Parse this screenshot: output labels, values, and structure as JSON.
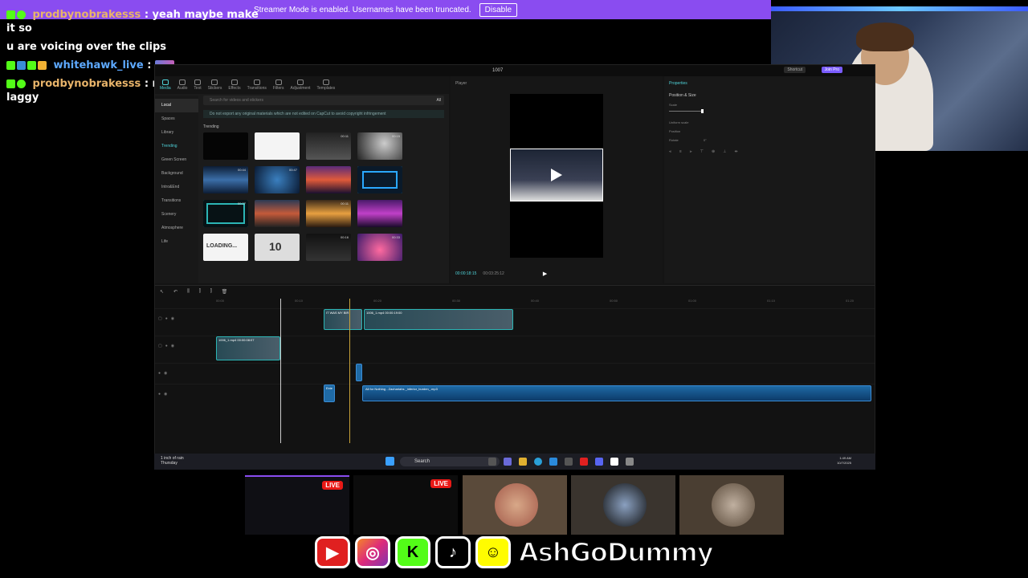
{
  "banner": {
    "text": "Streamer Mode is enabled. Usernames have been truncated.",
    "button": "Disable",
    "color": "#8a4cf0"
  },
  "chat": [
    {
      "user": "prodbynobrakesss",
      "text": ": yeah maybe make it so",
      "user_color": "#e8b46a"
    },
    {
      "user": "",
      "text": "u are voicing over the clips",
      "user_color": ""
    },
    {
      "user": "whitehawk_live",
      "text": ":",
      "user_color": "#5da9ff"
    },
    {
      "user": "prodbynobrakesss",
      "text": ": my wifi was hella laggy",
      "user_color": "#e8b46a"
    }
  ],
  "editor": {
    "window_title": "1007",
    "shortcut": "Shortcut",
    "join_pro": "Join Pro",
    "toolbar": [
      "Media",
      "Audio",
      "Text",
      "Stickers",
      "Effects",
      "Transitions",
      "Filters",
      "Adjustment",
      "Templates"
    ],
    "sidebar": [
      "Local",
      "Spaces",
      "Library",
      "Trending",
      "Green Screen",
      "Background",
      "Intro&End",
      "Transitions",
      "Scenery",
      "Atmosphere",
      "Life"
    ],
    "search_placeholder": "Search for videos and stickers",
    "search_filter": "All",
    "notice": "Do not export any original materials which are not edited on CapCut to avoid copyright infringement",
    "section": "Trending",
    "thumbs": [
      {
        "dur": "",
        "label": ""
      },
      {
        "dur": "",
        "label": ""
      },
      {
        "dur": "00:11",
        "label": ""
      },
      {
        "dur": "00:15",
        "label": ""
      },
      {
        "dur": "00:44",
        "label": ""
      },
      {
        "dur": "00:47",
        "label": ""
      },
      {
        "dur": "",
        "label": ""
      },
      {
        "dur": "",
        "label": ""
      },
      {
        "dur": "00:37",
        "label": ""
      },
      {
        "dur": "",
        "label": ""
      },
      {
        "dur": "00:11",
        "label": ""
      },
      {
        "dur": "",
        "label": ""
      },
      {
        "dur": "",
        "label": "LOADING..."
      },
      {
        "dur": "",
        "label": "10"
      },
      {
        "dur": "00:16",
        "label": ""
      },
      {
        "dur": "00:33",
        "label": ""
      }
    ],
    "player": {
      "header": "Player",
      "current_time": "00:00:18:15",
      "total_time": "00:03:25:12"
    },
    "properties": {
      "header": "Properties",
      "section": "Position & Size",
      "scale": "Scale",
      "uniform": "Uniform scale",
      "position": "Position",
      "rotate": "Rotate",
      "rotate_value": "0°"
    },
    "timeline": {
      "ruler": [
        "00:00",
        "00:10",
        "00:20",
        "00:30",
        "00:40",
        "00:50",
        "01:00",
        "01:10",
        "01:20"
      ],
      "clip_a": "IT WAS MY BIR",
      "clip_b": "1006_1.mp4  00:00:19:00",
      "clip_c": "1006_1.mp4  00:00:08:07",
      "clip_d": "Exte",
      "audio": "All for Nothing - Zachariahs  _inferior_burden_.mp3"
    }
  },
  "taskbar": {
    "weather_line1": "1 inch of rain",
    "weather_line2": "Thursday",
    "search": "Search",
    "time": "1:49 AM",
    "date": "10/7/2025"
  },
  "strip": {
    "live1": "LIVE",
    "live2": "LIVE"
  },
  "social": {
    "handle": "AshGoDummy"
  }
}
